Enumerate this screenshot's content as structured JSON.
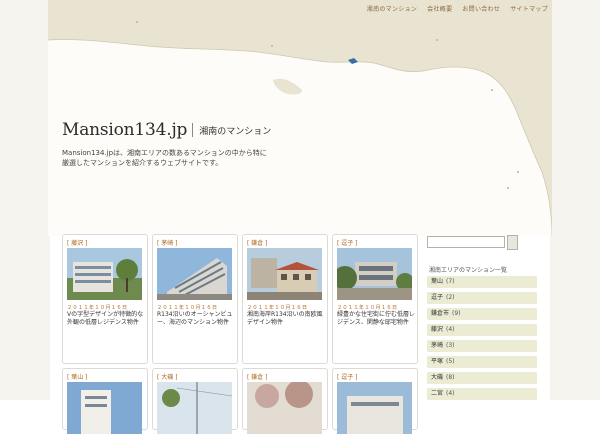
{
  "nav": {
    "items": [
      "湘南のマンション",
      "会社概要",
      "お問い合わせ",
      "サイトマップ"
    ]
  },
  "site": {
    "logo": "Mansion134.jp",
    "tagline": "湘南のマンション",
    "description": "Mansion134.jpは、湘南エリアの数あるマンションの中から特に厳選したマンションを紹介するウェブサイトです。"
  },
  "posts": [
    {
      "category": "[ 藤沢 ]",
      "date": "２０１１年１０月１６日",
      "title": "Vの字型デザインが特徴的な外観の低層レジデンス物件"
    },
    {
      "category": "[ 茅崎 ]",
      "date": "２０１１年１０月１６日",
      "title": "R134沿いのオーシャンビュー、海辺のマンション物件"
    },
    {
      "category": "[ 鎌倉 ]",
      "date": "２０１１年１０月１６日",
      "title": "湘南海岸R134沿いの南欧風デザイン物件"
    },
    {
      "category": "[ 逗子 ]",
      "date": "２０１１年１０月１６日",
      "title": "緑豊かな住宅街に佇む低層レジデンス、閑静な邸宅物件"
    },
    {
      "category": "[ 葉山 ]",
      "date": "",
      "title": ""
    },
    {
      "category": "[ 大磯 ]",
      "date": "",
      "title": ""
    },
    {
      "category": "[ 鎌倉 ]",
      "date": "",
      "title": ""
    },
    {
      "category": "[ 逗子 ]",
      "date": "",
      "title": ""
    }
  ],
  "sidebar": {
    "heading": "湘南エリアのマンション一覧",
    "categories": [
      {
        "label": "葉山",
        "count": "(7)"
      },
      {
        "label": "逗子",
        "count": "(2)"
      },
      {
        "label": "鎌倉市",
        "count": "(9)"
      },
      {
        "label": "藤沢",
        "count": "(4)"
      },
      {
        "label": "茅崎",
        "count": "(3)"
      },
      {
        "label": "平塚",
        "count": "(5)"
      },
      {
        "label": "大磯",
        "count": "(8)"
      },
      {
        "label": "二宮",
        "count": "(4)"
      }
    ]
  },
  "colors": {
    "accent": "#b06a22",
    "map_sea": "#e9e4d2",
    "map_coast": "#fdfcf8",
    "sidebar_item": "#ecebd3"
  }
}
